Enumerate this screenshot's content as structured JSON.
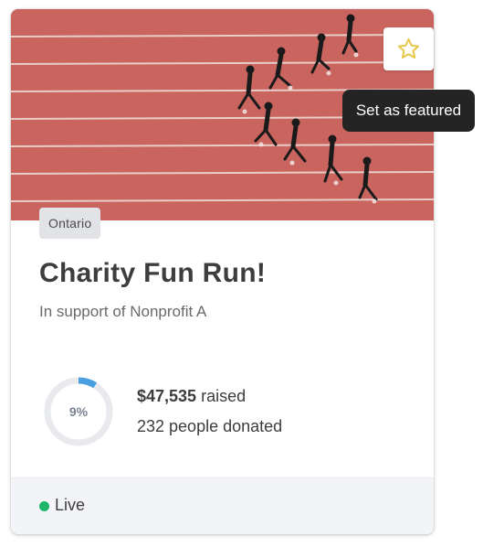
{
  "card": {
    "image_alt": "Runners on a red running track seen from above",
    "region_tag": "Ontario",
    "title": "Charity Fun Run!",
    "subtitle": "In support of Nonprofit A",
    "progress": {
      "percent_label": "9%",
      "fraction": 0.09
    },
    "raised_amount": "$47,535",
    "raised_suffix": " raised",
    "donors_text": "232 people donated",
    "status": {
      "label": "Live",
      "color": "#1fb56a"
    }
  },
  "featured_button": {
    "icon": "star-outline-icon",
    "color": "#e8c84a"
  },
  "tooltip": {
    "text": "Set as featured"
  },
  "colors": {
    "track": "#c9645e",
    "progress_track": "#e9eaed",
    "progress_fill": "#4a9fe0"
  }
}
